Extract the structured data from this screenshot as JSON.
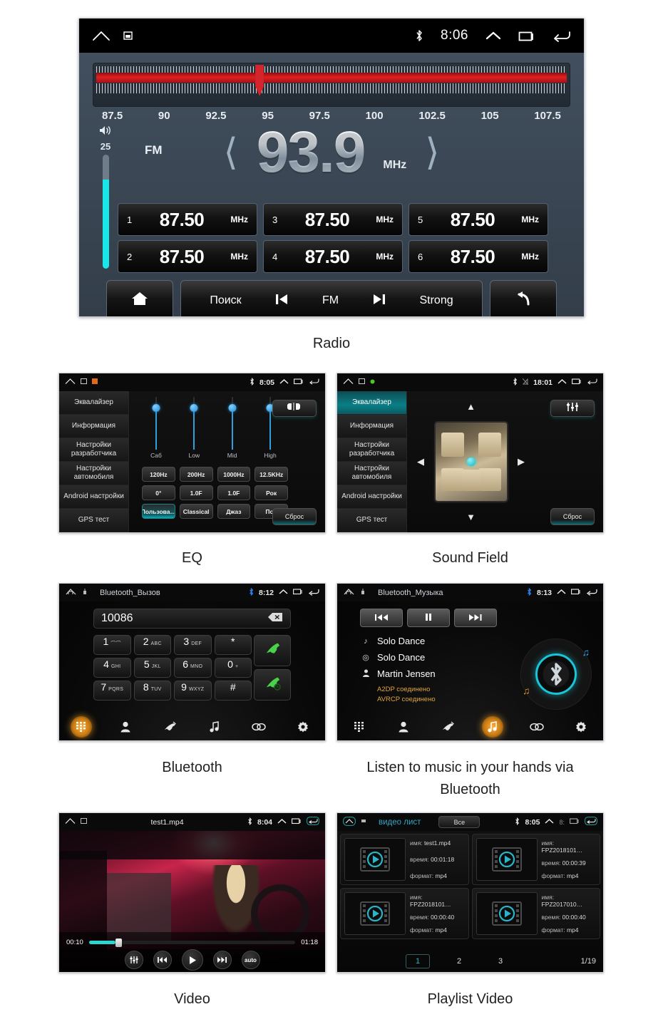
{
  "radio": {
    "status": {
      "time": "8:06",
      "bluetooth_icon": "bluetooth-icon",
      "home_icon": "home-icon",
      "screenshot_icon": "screenshot-icon",
      "up_icon": "chevron-up-icon",
      "recents_icon": "recents-icon",
      "back_icon": "back-icon"
    },
    "tuner": {
      "labels": [
        "87.5",
        "90",
        "92.5",
        "95",
        "97.5",
        "100",
        "102.5",
        "105",
        "107.5"
      ],
      "needle_percent": 34
    },
    "volume": {
      "value": "25",
      "icon": "volume-icon",
      "level_percent": 78
    },
    "band": "FM",
    "frequency": "93.9",
    "unit": "MHz",
    "prev_icon": "chevron-left-icon",
    "next_icon": "chevron-right-icon",
    "presets": [
      {
        "num": "1",
        "freq": "87.50",
        "unit": "MHz"
      },
      {
        "num": "3",
        "freq": "87.50",
        "unit": "MHz"
      },
      {
        "num": "5",
        "freq": "87.50",
        "unit": "MHz"
      },
      {
        "num": "2",
        "freq": "87.50",
        "unit": "MHz"
      },
      {
        "num": "4",
        "freq": "87.50",
        "unit": "MHz"
      },
      {
        "num": "6",
        "freq": "87.50",
        "unit": "MHz"
      }
    ],
    "bottom": {
      "home_icon": "home-icon",
      "search": "Поиск",
      "prev_icon": "skip-prev-icon",
      "band": "FM",
      "next_icon": "skip-next-icon",
      "strong": "Strong",
      "back_icon": "back-arrow-icon"
    },
    "caption": "Radio"
  },
  "eq": {
    "status": {
      "time": "8:05"
    },
    "menu": [
      {
        "label": "Эквалайзер",
        "active": false
      },
      {
        "label": "Информация",
        "active": false
      },
      {
        "label": "Настройки разработчика",
        "active": false
      },
      {
        "label": "Настройки автомобиля",
        "active": false
      },
      {
        "label": "Android настройки",
        "active": false
      },
      {
        "label": "GPS тест",
        "active": false
      }
    ],
    "sliders": [
      {
        "label": "Саб"
      },
      {
        "label": "Low"
      },
      {
        "label": "Mid"
      },
      {
        "label": "High"
      }
    ],
    "buttons": [
      {
        "label": "120Hz",
        "sel": false
      },
      {
        "label": "200Hz",
        "sel": false
      },
      {
        "label": "1000Hz",
        "sel": false
      },
      {
        "label": "12.5KHz",
        "sel": false
      },
      {
        "label": "0°",
        "sel": false
      },
      {
        "label": "1.0F",
        "sel": false
      },
      {
        "label": "1.0F",
        "sel": false
      },
      {
        "label": "Рок",
        "sel": false
      },
      {
        "label": "Пользова…",
        "sel": true
      },
      {
        "label": "Classical",
        "sel": false
      },
      {
        "label": "Джаз",
        "sel": false
      },
      {
        "label": "Поп",
        "sel": false
      }
    ],
    "mix_icon": "balance-icon",
    "reset": "Сброс",
    "caption": "EQ"
  },
  "soundfield": {
    "status": {
      "time": "18:01"
    },
    "menu": [
      {
        "label": "Эквалайзер",
        "active": true
      },
      {
        "label": "Информация",
        "active": false
      },
      {
        "label": "Настройки разработчика",
        "active": false
      },
      {
        "label": "Настройки автомобиля",
        "active": false
      },
      {
        "label": "Android настройки",
        "active": false
      },
      {
        "label": "GPS тест",
        "active": false
      }
    ],
    "up_icon": "triangle-up-icon",
    "down_icon": "triangle-down-icon",
    "left_icon": "triangle-left-icon",
    "right_icon": "triangle-right-icon",
    "eq_icon": "equalizer-icon",
    "reset": "Сброс",
    "caption": "Sound Field"
  },
  "bluetooth": {
    "status": {
      "title": "Bluetooth_Вызов",
      "time": "8:12"
    },
    "dialed_number": "10086",
    "backspace_icon": "backspace-icon",
    "keys": [
      {
        "d": "1",
        "s": "⌒⌒"
      },
      {
        "d": "2",
        "s": "ABC"
      },
      {
        "d": "3",
        "s": "DEF"
      },
      {
        "d": "*",
        "s": ""
      },
      {
        "d": "4",
        "s": "GHI"
      },
      {
        "d": "5",
        "s": "JKL"
      },
      {
        "d": "6",
        "s": "MNO"
      },
      {
        "d": "0",
        "s": "+"
      },
      {
        "d": "7",
        "s": "PQRS"
      },
      {
        "d": "8",
        "s": "TUV"
      },
      {
        "d": "9",
        "s": "WXYZ"
      },
      {
        "d": "#",
        "s": ""
      }
    ],
    "call_icon": "call-icon",
    "hangup_icon": "hangup-icon",
    "nav": [
      {
        "icon": "dialpad-icon",
        "active": true
      },
      {
        "icon": "contacts-icon",
        "active": false
      },
      {
        "icon": "call-history-icon",
        "active": false
      },
      {
        "icon": "music-note-icon",
        "active": false
      },
      {
        "icon": "link-icon",
        "active": false
      },
      {
        "icon": "gear-icon",
        "active": false
      }
    ],
    "caption": "Bluetooth"
  },
  "btmusic": {
    "status": {
      "title": "Bluetooth_Музыка",
      "time": "8:13"
    },
    "controls": [
      {
        "icon": "prev-track-icon"
      },
      {
        "icon": "pause-icon"
      },
      {
        "icon": "next-track-icon"
      }
    ],
    "track": "Solo Dance",
    "album": "Solo Dance",
    "artist": "Martin Jensen",
    "a2dp": "A2DP соединено",
    "avrcp": "AVRCP соединено",
    "disc_icon": "bluetooth-disc-icon",
    "nav": [
      {
        "icon": "dialpad-icon",
        "active": false
      },
      {
        "icon": "contacts-icon",
        "active": false
      },
      {
        "icon": "call-history-icon",
        "active": false
      },
      {
        "icon": "music-note-icon",
        "active": true
      },
      {
        "icon": "link-icon",
        "active": false
      },
      {
        "icon": "gear-icon",
        "active": false
      }
    ],
    "caption": "Listen to music in your hands via Bluetooth"
  },
  "video": {
    "status": {
      "title": "test1.mp4",
      "time": "8:04"
    },
    "elapsed": "00:10",
    "duration": "01:18",
    "progress_percent": 13,
    "buttons": [
      {
        "icon": "equalizer-icon",
        "label": ""
      },
      {
        "icon": "prev-track-icon",
        "label": ""
      },
      {
        "icon": "play-icon",
        "label": ""
      },
      {
        "icon": "next-track-icon",
        "label": ""
      },
      {
        "icon": "auto-icon",
        "label": "auto"
      }
    ],
    "caption": "Video"
  },
  "playlist": {
    "status": {
      "title": "видео лист",
      "filter": "Все",
      "time": "8:05",
      "time2": "8:"
    },
    "labels": {
      "name": "имя:",
      "time": "время:",
      "format": "формат:"
    },
    "items": [
      {
        "name": "test1.mp4",
        "time": "00:01:18",
        "format": "mp4"
      },
      {
        "name": "FPZ2018101…",
        "time": "00:00:39",
        "format": "mp4"
      },
      {
        "name": "FPZ2018101…",
        "time": "00:00:40",
        "format": "mp4"
      },
      {
        "name": "FPZ2017010…",
        "time": "00:00:40",
        "format": "mp4"
      }
    ],
    "pages": [
      "1",
      "2",
      "3"
    ],
    "current_page": "1",
    "page_total": "1/19",
    "caption": "Playlist Video"
  },
  "colors": {
    "accent_cyan": "#19c5d6",
    "accent_orange": "#e0a63c",
    "radio_red": "#e02020",
    "slider_blue": "#2f9fe0",
    "panel_bg": "#3b4754"
  }
}
